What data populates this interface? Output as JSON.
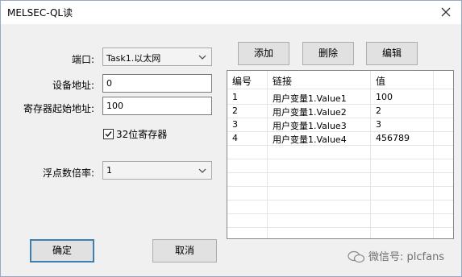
{
  "window": {
    "title": "MELSEC-QL读"
  },
  "form": {
    "port_label": "端口:",
    "port_value": "Task1.以太网",
    "device_addr_label": "设备地址:",
    "device_addr_value": "0",
    "reg_start_label": "寄存器起始地址:",
    "reg_start_value": "100",
    "reg32_label": "32位寄存器",
    "reg32_checked": true,
    "float_rate_label": "浮点数倍率:",
    "float_rate_value": "1"
  },
  "toolbar": {
    "add": "添加",
    "delete": "删除",
    "edit": "编辑"
  },
  "table": {
    "columns": [
      "编号",
      "链接",
      "值"
    ],
    "rows": [
      [
        "1",
        "用户变量1.Value1",
        "100"
      ],
      [
        "2",
        "用户变量1.Value2",
        "2"
      ],
      [
        "3",
        "用户变量1.Value3",
        "3"
      ],
      [
        "4",
        "用户变量1.Value4",
        "456789"
      ]
    ]
  },
  "footer": {
    "ok": "确定",
    "cancel": "取消"
  },
  "watermark": {
    "text": "微信号: plcfans"
  }
}
